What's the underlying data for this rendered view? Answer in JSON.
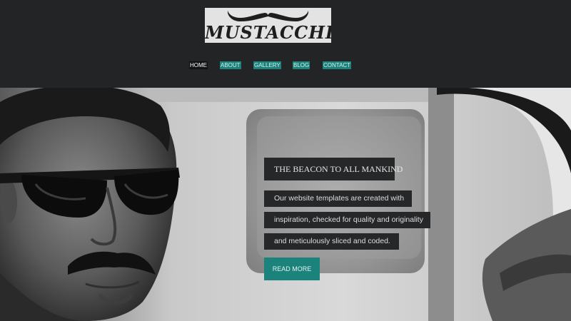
{
  "header": {
    "logo_text": "MUSTACCHIO",
    "logo_icon": "mustache-icon"
  },
  "nav": {
    "items": [
      {
        "label": "HOME",
        "active": true
      },
      {
        "label": "ABOUT",
        "active": false
      },
      {
        "label": "GALLERY",
        "active": false
      },
      {
        "label": "BLOG",
        "active": false
      },
      {
        "label": "CONTACT",
        "active": false
      }
    ]
  },
  "hero": {
    "title": "THE BEACON TO ALL MANKIND",
    "lines": [
      "Our website templates are created with",
      "inspiration, checked for quality and originality",
      "and meticulously sliced and coded."
    ],
    "button_label": "READ MORE"
  },
  "colors": {
    "header_bg": "#232426",
    "accent": "#1b827c",
    "caption_bg": "#262729"
  }
}
